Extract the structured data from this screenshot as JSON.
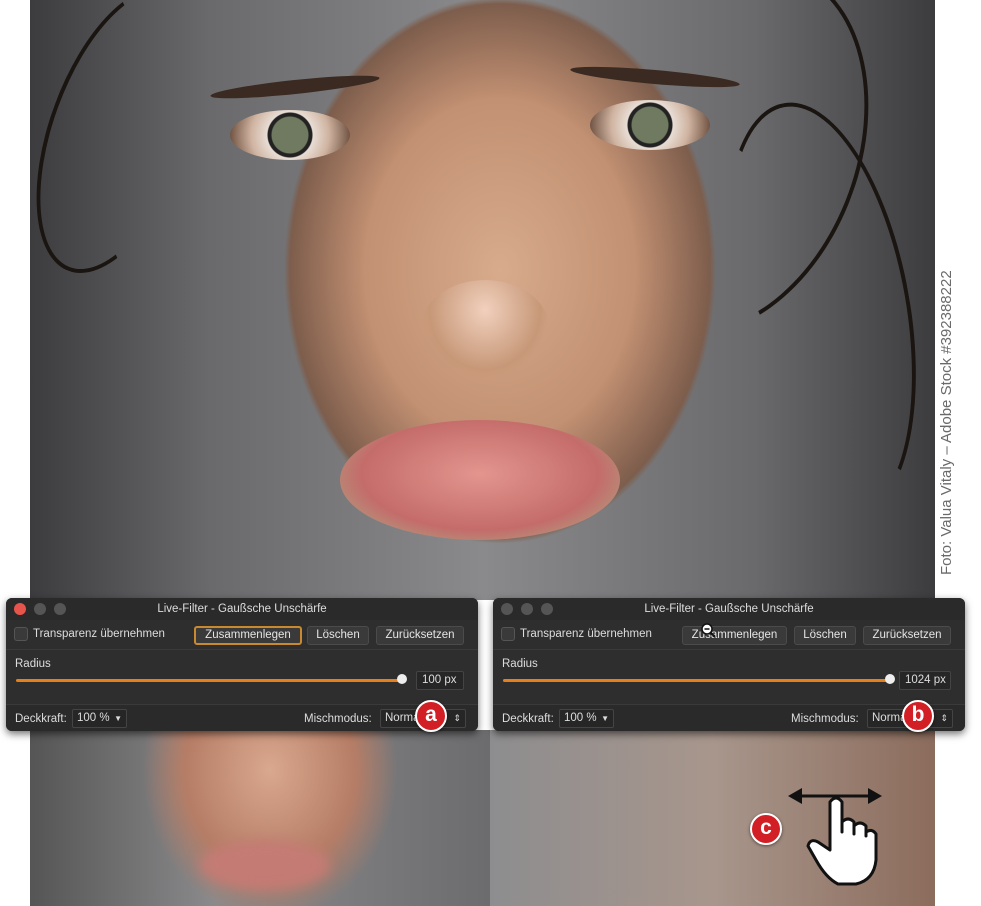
{
  "credit": "Foto: Valua Vitaly – Adobe Stock #392388222",
  "panels": [
    {
      "title": "Live-Filter - Gaußsche Unschärfe",
      "transparency_label": "Transparenz übernehmen",
      "buttons": {
        "merge": "Zusammenlegen",
        "delete": "Löschen",
        "reset": "Zurücksetzen"
      },
      "radius_label": "Radius",
      "radius_value": "100 px",
      "opacity_label": "Deckkraft:",
      "opacity_value": "100 %",
      "blend_label": "Mischmodus:",
      "blend_value": "Normal",
      "badge": "a"
    },
    {
      "title": "Live-Filter - Gaußsche Unschärfe",
      "transparency_label": "Transparenz übernehmen",
      "buttons": {
        "merge": "Zusammenlegen",
        "delete": "Löschen",
        "reset": "Zurücksetzen"
      },
      "radius_label": "Radius",
      "radius_value": "1024 px",
      "opacity_label": "Deckkraft:",
      "opacity_value": "100 %",
      "blend_label": "Mischmodus:",
      "blend_value": "Normal",
      "badge": "b"
    }
  ],
  "badge_c": "c",
  "colors": {
    "accent": "#e6801a",
    "badge": "#d11f25",
    "panel": "#2e2e2e"
  }
}
